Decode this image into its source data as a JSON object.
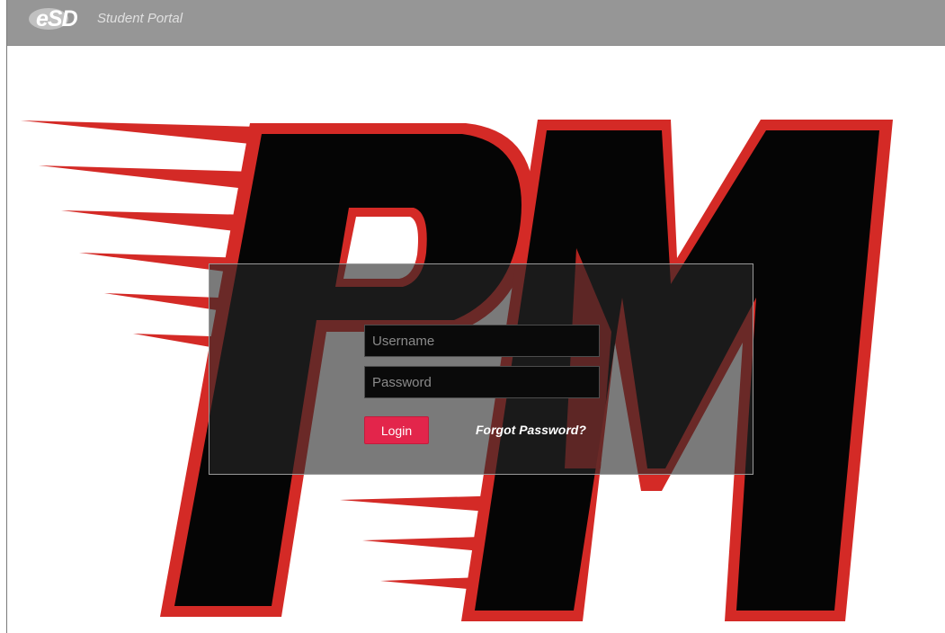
{
  "header": {
    "logo_text": "eSD",
    "portal_name": "Student Portal"
  },
  "background": {
    "emblem_text": "PM",
    "colors": {
      "letter_fill": "#050505",
      "outline": "#d42a26",
      "streak": "#d42a26"
    }
  },
  "login": {
    "username_placeholder": "Username",
    "username_value": "",
    "password_placeholder": "Password",
    "password_value": "",
    "login_label": "Login",
    "forgot_label": "Forgot Password?",
    "accent_color": "#e3254b"
  }
}
